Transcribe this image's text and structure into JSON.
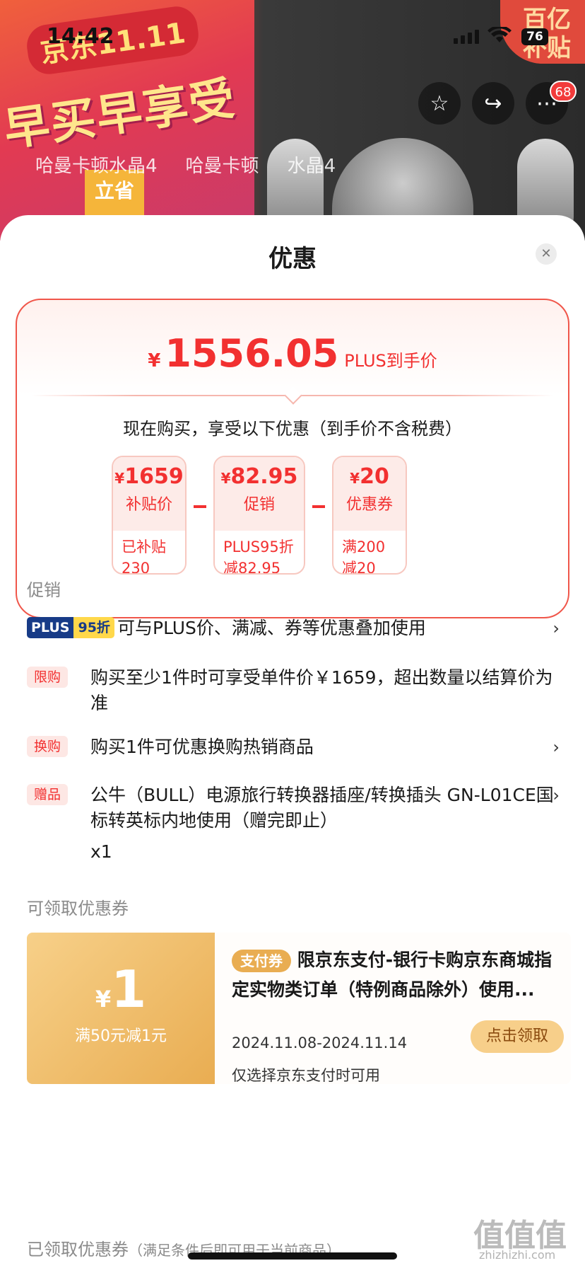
{
  "status": {
    "time": "14:42",
    "battery": "76"
  },
  "background": {
    "banner_tag": "京东11.11",
    "banner_big": "早买早享受",
    "banner_sub": "立省",
    "subsidy_badge": "百亿补贴",
    "search_items": [
      "哈曼卡顿水晶4",
      "哈曼卡顿",
      "水晶4"
    ],
    "cart_count": "68"
  },
  "sheet": {
    "title": "优惠",
    "price": {
      "currency": "¥",
      "amount": "1556.05",
      "label": "PLUS到手价"
    },
    "description": "现在购买，享受以下优惠（到手价不含税费）",
    "chips": [
      {
        "currency": "¥",
        "value": "1659",
        "name": "补贴价",
        "detail": "已补贴\n230"
      },
      {
        "currency": "¥",
        "value": "82.95",
        "name": "促销",
        "detail": "PLUS95折\n减82.95"
      },
      {
        "currency": "¥",
        "value": "20",
        "name": "优惠券",
        "detail": "满200\n减20"
      }
    ]
  },
  "promotions": {
    "label": "促销",
    "plus_tag": {
      "left": "PLUS",
      "right": "95折"
    },
    "plus_text": "可与PLUS价、满减、券等优惠叠加使用",
    "items": [
      {
        "tag": "限购",
        "text": "购买至少1件时可享受单件价￥1659，超出数量以结算价为准"
      },
      {
        "tag": "换购",
        "text": "购买1件可优惠换购热销商品"
      },
      {
        "tag": "赠品",
        "text": "公牛（BULL）电源旅行转换器插座/转换插头 GN-L01CE国标转英标内地使用（赠完即止）",
        "qty": "x1"
      }
    ]
  },
  "coupons": {
    "label": "可领取优惠券",
    "items": [
      {
        "currency": "¥",
        "amount": "1",
        "condition": "满50元减1元",
        "type_tag": "支付券",
        "title": "限京东支付-银行卡购京东商城指定实物类订单（特例商品除外）使用...",
        "date": "2024.11.08-2024.11.14",
        "note": "仅选择京东支付时可用",
        "button": "点击领取"
      }
    ],
    "claimed_label": "已领取优惠券",
    "claimed_hint": "（满足条件后即可用于当前商品）"
  },
  "watermark": {
    "main": "值值值",
    "sub": "zhizhizhi.com"
  },
  "colors": {
    "accent_red": "#f23030",
    "coupon_gold": "#e9ad52",
    "plus_blue": "#173b87"
  }
}
